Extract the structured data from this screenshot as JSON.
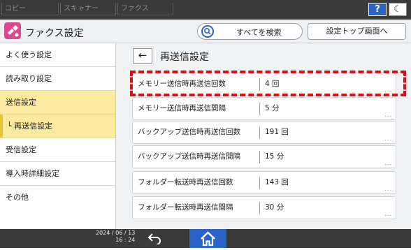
{
  "top_tabs": [
    "コピー",
    "スキャナー",
    "ファクス"
  ],
  "header": {
    "title": "ファクス設定",
    "search_label": "すべてを検索",
    "settings_top_label": "設定トップ画面へ"
  },
  "sidebar": {
    "items": [
      {
        "label": "よく使う設定"
      },
      {
        "label": "読み取り設定"
      },
      {
        "label": "送信設定"
      },
      {
        "label": "└ 再送信設定"
      },
      {
        "label": "受信設定"
      },
      {
        "label": "導入時詳細設定"
      },
      {
        "label": "その他"
      }
    ]
  },
  "main": {
    "title": "再送信設定",
    "rows": [
      {
        "label": "メモリー送信時再送信回数",
        "value": "4 回"
      },
      {
        "label": "メモリー送信時再送信間隔",
        "value": "5 分"
      },
      {
        "label": "バックアップ送信時再送信回数",
        "value": "191 回"
      },
      {
        "label": "バックアップ送信時再送信間隔",
        "value": "15 分"
      },
      {
        "label": "フォルダー転送時再送信回数",
        "value": "143 回"
      },
      {
        "label": "フォルダー転送時再送信間隔",
        "value": "30 分"
      }
    ]
  },
  "status": {
    "date": "2024 / 06 / 13",
    "time": "16 : 24"
  },
  "colors": {
    "accent": "#2a64c8",
    "highlight": "#d41414",
    "active_bg": "#fbeaa0"
  }
}
